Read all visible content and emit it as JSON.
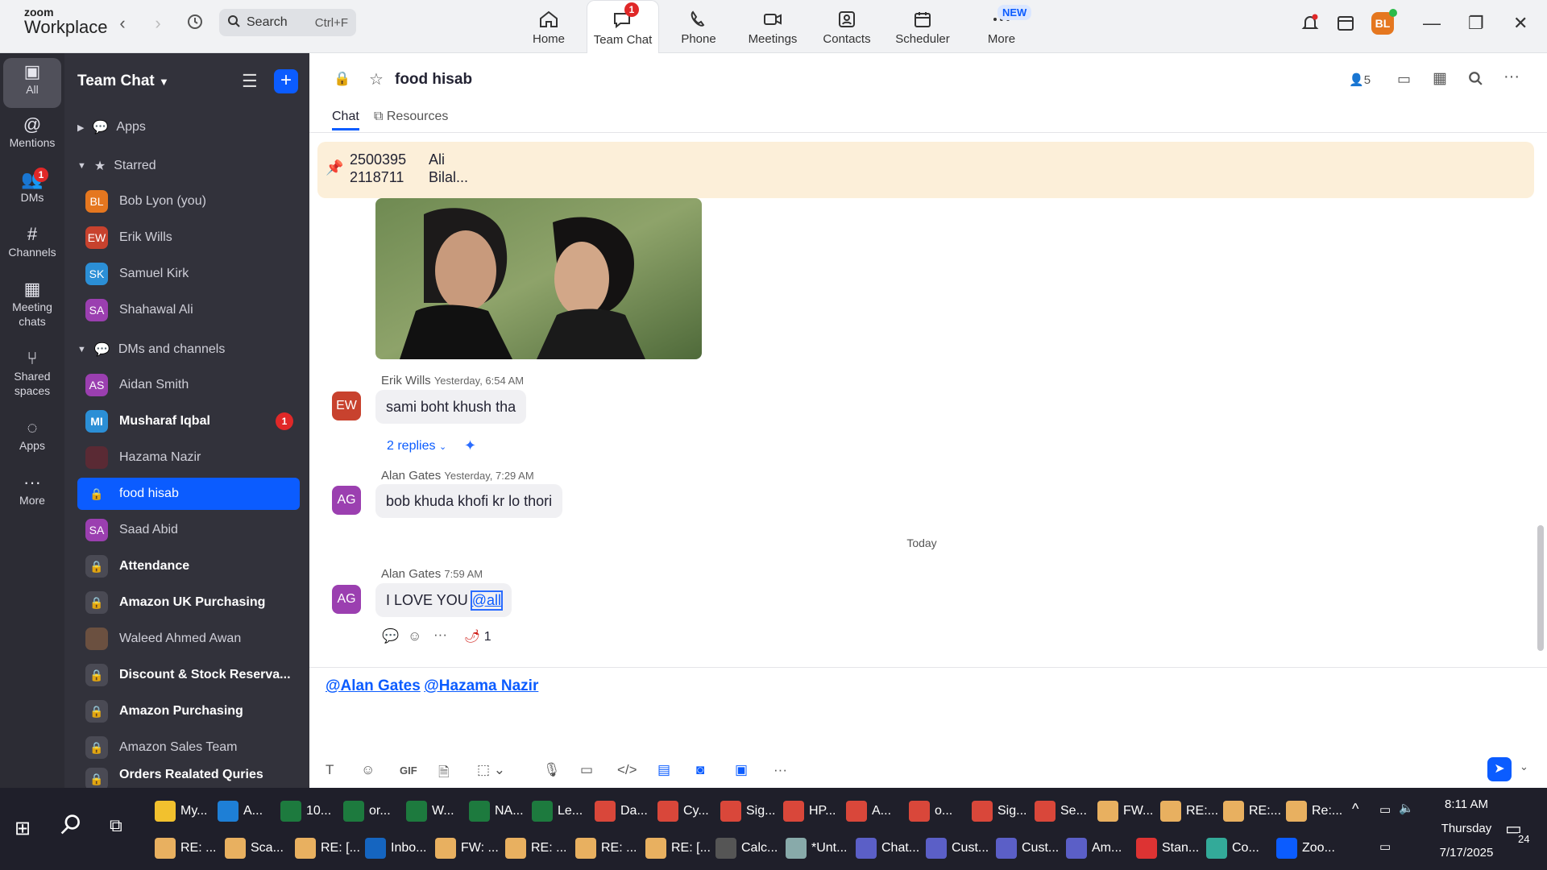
{
  "app": {
    "brand_small": "zoom",
    "brand_large": "Workplace"
  },
  "search": {
    "placeholder": "Search",
    "shortcut": "Ctrl+F"
  },
  "nav": {
    "tabs": [
      {
        "label": "Home"
      },
      {
        "label": "Team Chat",
        "badge": "1"
      },
      {
        "label": "Phone"
      },
      {
        "label": "Meetings"
      },
      {
        "label": "Contacts"
      },
      {
        "label": "Scheduler"
      },
      {
        "label": "More",
        "badge": "NEW"
      }
    ]
  },
  "user": {
    "initials": "BL"
  },
  "rail": {
    "items": [
      {
        "label": "All"
      },
      {
        "label": "Mentions"
      },
      {
        "label": "DMs",
        "badge": "1"
      },
      {
        "label": "Channels"
      },
      {
        "label": "Meeting chats"
      },
      {
        "label": "Shared spaces"
      },
      {
        "label": "Apps"
      },
      {
        "label": "More"
      }
    ]
  },
  "sidebar": {
    "title": "Team Chat",
    "apps_label": "Apps",
    "starred_label": "Starred",
    "starred": [
      {
        "initials": "BL",
        "name": "Bob Lyon (you)",
        "color": "#e5771f"
      },
      {
        "initials": "EW",
        "name": "Erik Wills",
        "color": "#c8422e"
      },
      {
        "initials": "SK",
        "name": "Samuel Kirk",
        "color": "#2b8fd6"
      },
      {
        "initials": "SA",
        "name": "Shahawal Ali",
        "color": "#9b3fb0"
      }
    ],
    "dm_label": "DMs and channels",
    "dms": [
      {
        "initials": "AS",
        "name": "Aidan Smith",
        "color": "#9b3fb0"
      },
      {
        "initials": "MI",
        "name": "Musharaf Iqbal",
        "color": "#2b8fd6",
        "badge": "1"
      },
      {
        "initials": "",
        "name": "Hazama Nazir",
        "color": "#5a2a34"
      },
      {
        "initials": "",
        "name": "food hisab",
        "color": "#0b5cff"
      },
      {
        "initials": "SA",
        "name": "Saad Abid",
        "color": "#9b3fb0"
      },
      {
        "initials": "",
        "name": "Attendance",
        "color": "#4a4a54"
      },
      {
        "initials": "",
        "name": "Amazon UK Purchasing",
        "color": "#4a4a54"
      },
      {
        "initials": "",
        "name": "Waleed Ahmed Awan",
        "color": "#6b5040"
      },
      {
        "initials": "",
        "name": "Discount & Stock Reserva...",
        "color": "#4a4a54"
      },
      {
        "initials": "",
        "name": "Amazon Purchasing",
        "color": "#4a4a54"
      },
      {
        "initials": "",
        "name": "Amazon Sales Team",
        "color": "#4a4a54"
      },
      {
        "initials": "",
        "name": "Orders Realated Quries",
        "color": "#4a4a54"
      }
    ]
  },
  "channel": {
    "name": "food hisab",
    "members": "5",
    "tabs": {
      "chat": "Chat",
      "resources": "Resources"
    }
  },
  "pinned": {
    "line1_a": "2500395",
    "line1_b": "Ali",
    "line2_a": "2118711",
    "line2_b": "Bilal..."
  },
  "messages": [
    {
      "initials": "EW",
      "sender": "Erik Wills",
      "time": "Yesterday, 6:54 AM",
      "text": "sami boht khush tha",
      "color": "#c8422e",
      "replies": "2 replies"
    },
    {
      "initials": "AG",
      "sender": "Alan Gates",
      "time": "Yesterday, 7:29 AM",
      "text": "bob khuda khofi kr lo thori",
      "color": "#9b3fb0"
    },
    {
      "initials": "AG",
      "sender": "Alan Gates",
      "time": "7:59 AM",
      "text": "I LOVE YOU",
      "mention": "@all",
      "color": "#9b3fb0",
      "reaction_count": "1"
    }
  ],
  "divider": {
    "today": "Today"
  },
  "composer": {
    "mention1": "@Alan Gates",
    "mention2": "@Hazama Nazir"
  },
  "taskbar": {
    "row1": [
      {
        "label": "My...",
        "color": "#f2c12e"
      },
      {
        "label": "A...",
        "color": "#1e7fd6"
      },
      {
        "label": "10...",
        "color": "#1d7a3e"
      },
      {
        "label": "or...",
        "color": "#1d7a3e"
      },
      {
        "label": "W...",
        "color": "#1d7a3e"
      },
      {
        "label": "NA...",
        "color": "#1d7a3e"
      },
      {
        "label": "Le...",
        "color": "#1d7a3e"
      },
      {
        "label": "Da...",
        "color": "#d9473a"
      },
      {
        "label": "Cy...",
        "color": "#d9473a"
      },
      {
        "label": "Sig...",
        "color": "#d9473a"
      },
      {
        "label": "HP...",
        "color": "#d9473a"
      },
      {
        "label": "A...",
        "color": "#d9473a"
      },
      {
        "label": "o...",
        "color": "#d9473a"
      },
      {
        "label": "Sig...",
        "color": "#d9473a"
      },
      {
        "label": "Se...",
        "color": "#d9473a"
      },
      {
        "label": "FW...",
        "color": "#e8b060"
      },
      {
        "label": "RE:...",
        "color": "#e8b060"
      },
      {
        "label": "RE:...",
        "color": "#e8b060"
      },
      {
        "label": "Re:...",
        "color": "#e8b060"
      }
    ],
    "row2": [
      {
        "label": "RE: ...",
        "color": "#e8b060"
      },
      {
        "label": "Sca...",
        "color": "#e8b060"
      },
      {
        "label": "RE: [...",
        "color": "#e8b060"
      },
      {
        "label": "Inbo...",
        "color": "#1565c0"
      },
      {
        "label": "FW: ...",
        "color": "#e8b060"
      },
      {
        "label": "RE: ...",
        "color": "#e8b060"
      },
      {
        "label": "RE: ...",
        "color": "#e8b060"
      },
      {
        "label": "RE: [...",
        "color": "#e8b060"
      },
      {
        "label": "Calc...",
        "color": "#555"
      },
      {
        "label": "*Unt...",
        "color": "#8aa"
      },
      {
        "label": "Chat...",
        "color": "#5b5fc7"
      },
      {
        "label": "Cust...",
        "color": "#5b5fc7"
      },
      {
        "label": "Cust...",
        "color": "#5b5fc7"
      },
      {
        "label": "Am...",
        "color": "#5b5fc7"
      },
      {
        "label": "Stan...",
        "color": "#d33"
      },
      {
        "label": "Co...",
        "color": "#3a9"
      },
      {
        "label": "Zoo...",
        "color": "#0b5cff"
      }
    ],
    "time": "8:11 AM",
    "day": "Thursday",
    "date": "7/17/2025",
    "notif": "24"
  }
}
